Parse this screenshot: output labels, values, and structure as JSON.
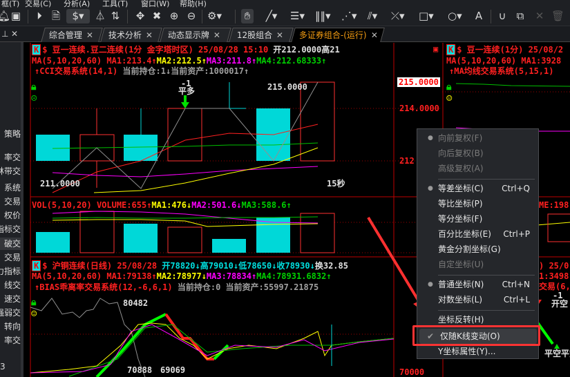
{
  "menubar": [
    "框(T)",
    "交易(C)",
    "分析(A)",
    "工具(T)",
    "窗口(W)",
    "帮助(H)"
  ],
  "toolbar": {
    "icons": [
      "bell-icon",
      "chart-icon",
      "play-icon",
      "document-icon",
      "dollar-icon",
      "filter-icon",
      "sort-icon",
      "move-icon",
      "cross-icon",
      "zoom-in-icon",
      "zoom-out-icon",
      "settings-icon",
      "hand-icon",
      "line-icon",
      "fib-icon",
      "vlines-icon",
      "fan-icon",
      "channel-icon",
      "cross-line-icon",
      "rectangle-icon",
      "circle-icon",
      "text-icon",
      "magnet-icon",
      "copy-icon",
      "close-icon",
      "trash-icon"
    ]
  },
  "tabs": [
    {
      "label": "综合管理"
    },
    {
      "label": "技术分析"
    },
    {
      "label": "动态显示牌"
    },
    {
      "label": "12股组合"
    },
    {
      "label": "多证券组合-(运行)"
    }
  ],
  "sidebar": {
    "items": [
      "策略",
      "率交",
      "林带交",
      "系统",
      "交易",
      "权价",
      "指标交",
      "破交",
      "交易",
      "力指标",
      "线交",
      "速交",
      "强弱交",
      "转向",
      "率交",
      "3"
    ]
  },
  "pane1": {
    "k": "K",
    "title": "$ 豆一连续.豆二连续(1分 金字塔时区) 25/08/28 15:10",
    "open": "开212.0000",
    "high": "高21",
    "ma": {
      "label": "MA(5,10,20,60)",
      "ma1": "MA1:213.4",
      "ma2": "MA2:212.5",
      "ma3": "MA3:211.8",
      "ma4": "MA4:212.68333"
    },
    "system": "CCI交易系统(14,1)",
    "position": "当前持仓:1",
    "assets": "当前资产:1000017",
    "signal_num": "-1",
    "signal": "平多",
    "high_label": "215.0000",
    "low_label": "211.0000",
    "timer": "15秒"
  },
  "axis1": {
    "tag": "215.0000",
    "labels": [
      "214.0000",
      "212"
    ]
  },
  "volume": {
    "label": "VOL(5,10,20)",
    "volume": "VOLUME:655",
    "ma1": "MA1:476",
    "ma2": "MA2:501.6",
    "ma3": "MA3:588.6"
  },
  "pane3": {
    "k": "K",
    "title": "$ 沪铜连续(日线) 25/08/28",
    "open": "开78820",
    "high": "高79010",
    "low": "低78650",
    "close": "收78930",
    "change": "换",
    "val": "32.85",
    "ma": {
      "label": "MA(5,10,20,60)",
      "ma1": "MA1:79138",
      "ma2": "MA2:78977",
      "ma3": "MA3:78834",
      "ma4": "MA4:78931.6832"
    },
    "system": "BIAS乖离率交易系统(12,-6,6,1)",
    "position": "当前持仓:0",
    "assets": "当前资产:55997.21875",
    "high_label": "80482",
    "low_label": "69069",
    "low2": "70888",
    "axis": "70000"
  },
  "right": {
    "title": "$ 豆一连续(1分) 25/08/2",
    "ma": "MA(5,10,20,60) MA1:3928",
    "system": "MA均线交易系统(5,15,1)",
    "volume": "ME:198",
    "p3_title": ") 25/0",
    "p3_ma": "1:3498",
    "p3_sys": "交易(6,",
    "sig1": "-1",
    "sig1b": "开空",
    "sig2": "-1",
    "sig2b": "开空",
    "sig3": "平空",
    "sig4": "平空"
  },
  "context_menu": {
    "items": [
      {
        "label": "向前复权(F)",
        "disabled": true,
        "dot": true
      },
      {
        "label": "向后复权(B)",
        "disabled": true
      },
      {
        "label": "高级复权(A)",
        "disabled": true
      },
      {
        "label": "等差坐标(C)",
        "shortcut": "Ctrl+Q",
        "dot": true
      },
      {
        "label": "等比坐标(P)"
      },
      {
        "label": "等分坐标(F)"
      },
      {
        "label": "百分比坐标(E)",
        "shortcut": "Ctrl+P"
      },
      {
        "label": "黄金分割坐标(G)"
      },
      {
        "label": "自定坐标(U)",
        "disabled": true
      },
      {
        "label": "普通坐标(N)",
        "shortcut": "Ctrl+N",
        "dot": true
      },
      {
        "label": "对数坐标(L)",
        "shortcut": "Ctrl+L"
      },
      {
        "label": "坐标反转(H)"
      },
      {
        "label": "仅随K线变动(O)",
        "checked": true
      },
      {
        "label": "Y坐标属性(Y)..."
      }
    ]
  },
  "colors": {
    "up": "#ff2020",
    "down": "#00d8d8",
    "ma1": "#ffff00",
    "ma2": "#ff00ff",
    "ma3": "#00c000",
    "highlight": "#ff3333"
  }
}
